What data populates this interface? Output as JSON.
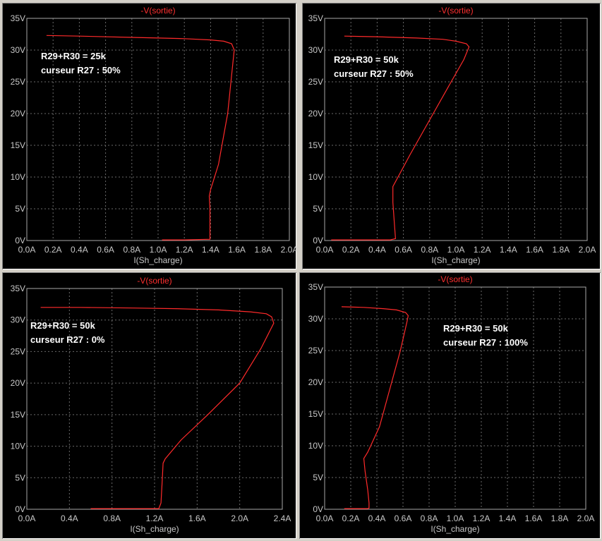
{
  "chart_data": [
    {
      "type": "line",
      "title": "-V(sortie)",
      "xlabel": "I(Sh_charge)",
      "ylabel": "",
      "xlim": [
        0,
        2.0
      ],
      "ylim": [
        0,
        35
      ],
      "x_ticks": [
        "0.0A",
        "0.2A",
        "0.4A",
        "0.6A",
        "0.8A",
        "1.0A",
        "1.2A",
        "1.4A",
        "1.6A",
        "1.8A",
        "2.0A"
      ],
      "y_ticks": [
        "0V",
        "5V",
        "10V",
        "15V",
        "20V",
        "25V",
        "30V",
        "35V"
      ],
      "annotations": [
        "R29+R30 = 25k",
        "curseur R27 : 50%"
      ],
      "x": [
        0.15,
        0.4,
        0.8,
        1.0,
        1.2,
        1.4,
        1.5,
        1.56,
        1.58,
        1.57,
        1.53,
        1.46,
        1.4,
        1.39,
        1.395,
        1.395,
        1.395,
        1.2,
        1.03
      ],
      "y": [
        32.3,
        32.2,
        32.0,
        31.9,
        31.8,
        31.6,
        31.4,
        31.0,
        30.0,
        28.0,
        20.0,
        12.0,
        8.0,
        7.0,
        5.0,
        2.0,
        0.2,
        0.1,
        0.1
      ]
    },
    {
      "type": "line",
      "title": "-V(sortie)",
      "xlabel": "I(Sh_charge)",
      "ylabel": "",
      "xlim": [
        0,
        2.0
      ],
      "ylim": [
        0,
        35
      ],
      "x_ticks": [
        "0.0A",
        "0.2A",
        "0.4A",
        "0.6A",
        "0.8A",
        "1.0A",
        "1.2A",
        "1.4A",
        "1.6A",
        "1.8A",
        "2.0A"
      ],
      "y_ticks": [
        "0V",
        "5V",
        "10V",
        "15V",
        "20V",
        "25V",
        "30V",
        "35V"
      ],
      "annotations": [
        "R29+R30 = 50k",
        "curseur R27 : 50%"
      ],
      "x": [
        0.15,
        0.4,
        0.7,
        0.9,
        1.0,
        1.08,
        1.1,
        1.06,
        0.95,
        0.8,
        0.65,
        0.52,
        0.52,
        0.53,
        0.54,
        0.5,
        0.35,
        0.05
      ],
      "y": [
        32.2,
        32.1,
        31.9,
        31.7,
        31.4,
        31.0,
        30.5,
        28.5,
        24.5,
        19.0,
        13.5,
        8.5,
        6.0,
        3.0,
        0.3,
        0.1,
        0.1,
        0.1
      ]
    },
    {
      "type": "line",
      "title": "-V(sortie)",
      "xlabel": "I(Sh_charge)",
      "ylabel": "",
      "xlim": [
        0,
        2.4
      ],
      "ylim": [
        0,
        35
      ],
      "x_ticks": [
        "0.0A",
        "0.4A",
        "0.8A",
        "1.2A",
        "1.6A",
        "2.0A",
        "2.4A"
      ],
      "y_ticks": [
        "0V",
        "5V",
        "10V",
        "15V",
        "20V",
        "25V",
        "30V",
        "35V"
      ],
      "annotations": [
        "R29+R30 = 50k",
        "curseur R27 : 0%"
      ],
      "x": [
        0.13,
        0.5,
        1.0,
        1.4,
        1.8,
        2.1,
        2.25,
        2.3,
        2.32,
        2.2,
        2.0,
        1.7,
        1.45,
        1.3,
        1.28,
        1.27,
        1.26,
        1.24,
        0.8,
        0.6
      ],
      "y": [
        32.0,
        32.0,
        31.9,
        31.8,
        31.6,
        31.3,
        31.0,
        30.5,
        29.5,
        25.5,
        20.0,
        15.0,
        11.0,
        8.0,
        7.3,
        4.0,
        1.0,
        0.1,
        0.1,
        0.1
      ]
    },
    {
      "type": "line",
      "title": "-V(sortie)",
      "xlabel": "I(Sh_charge)",
      "ylabel": "",
      "xlim": [
        0,
        2.0
      ],
      "ylim": [
        0,
        35
      ],
      "x_ticks": [
        "0.0A",
        "0.2A",
        "0.4A",
        "0.6A",
        "0.8A",
        "1.0A",
        "1.2A",
        "1.4A",
        "1.6A",
        "1.8A",
        "2.0A"
      ],
      "y_ticks": [
        "0V",
        "5V",
        "10V",
        "15V",
        "20V",
        "25V",
        "30V",
        "35V"
      ],
      "annotations": [
        "R29+R30 = 50k",
        "curseur R27 : 100%"
      ],
      "x": [
        0.13,
        0.3,
        0.45,
        0.55,
        0.62,
        0.64,
        0.63,
        0.58,
        0.5,
        0.42,
        0.33,
        0.3,
        0.31,
        0.33,
        0.34,
        0.34,
        0.33,
        0.25,
        0.15
      ],
      "y": [
        31.9,
        31.8,
        31.6,
        31.4,
        31.0,
        30.5,
        29.5,
        25.0,
        19.0,
        13.0,
        9.0,
        8.0,
        6.0,
        3.0,
        1.0,
        0.2,
        0.1,
        0.1,
        0.1
      ]
    }
  ]
}
